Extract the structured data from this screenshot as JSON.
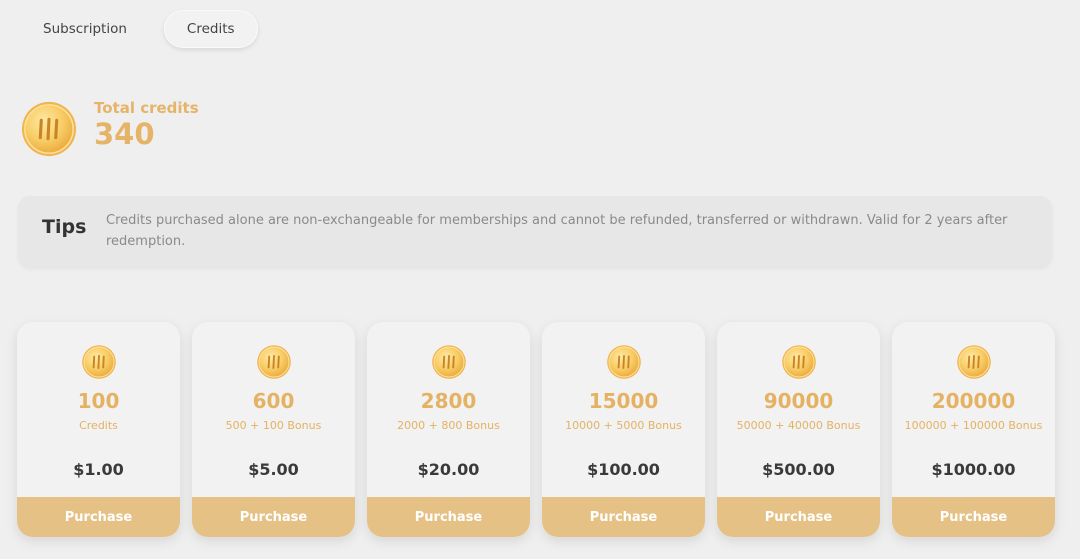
{
  "tabs": [
    {
      "label": "Subscription",
      "active": false
    },
    {
      "label": "Credits",
      "active": true
    }
  ],
  "total": {
    "label": "Total credits",
    "value": "340"
  },
  "tips": {
    "title": "Tips",
    "text": "Credits purchased alone are non-exchangeable for memberships and cannot be refunded, transferred or withdrawn. Valid for 2 years after redemption."
  },
  "packages": [
    {
      "amount": "100",
      "sub": "Credits",
      "price": "$1.00",
      "button": "Purchase"
    },
    {
      "amount": "600",
      "sub": "500 + 100 Bonus",
      "price": "$5.00",
      "button": "Purchase"
    },
    {
      "amount": "2800",
      "sub": "2000 + 800 Bonus",
      "price": "$20.00",
      "button": "Purchase"
    },
    {
      "amount": "15000",
      "sub": "10000 + 5000 Bonus",
      "price": "$100.00",
      "button": "Purchase"
    },
    {
      "amount": "90000",
      "sub": "50000 + 40000 Bonus",
      "price": "$500.00",
      "button": "Purchase"
    },
    {
      "amount": "200000",
      "sub": "100000 + 100000 Bonus",
      "price": "$1000.00",
      "button": "Purchase"
    }
  ],
  "icons": {
    "coin": "coin-icon"
  },
  "colors": {
    "accent": "#e5b468",
    "button": "#e6c186",
    "background": "#efefef"
  }
}
